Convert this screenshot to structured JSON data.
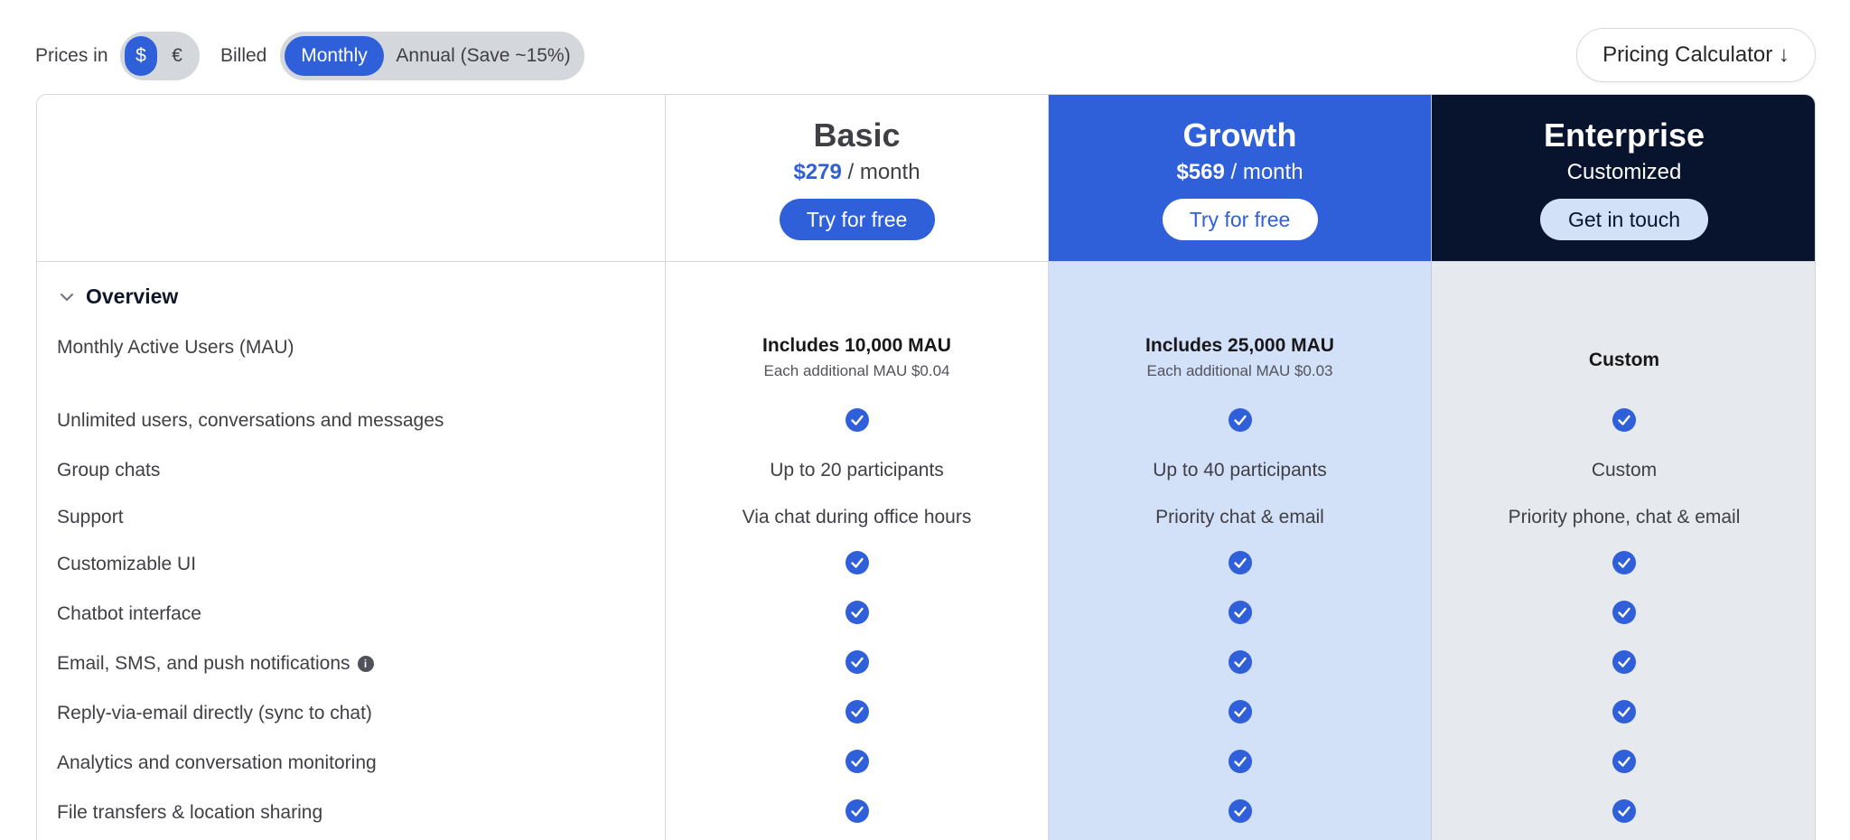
{
  "controls": {
    "prices_in_label": "Prices in",
    "currency_options": [
      "$",
      "€"
    ],
    "billed_label": "Billed",
    "billing_options": [
      "Monthly",
      "Annual (Save ~15%)"
    ],
    "selected_currency": "$",
    "selected_billing": "Monthly",
    "calculator_label": "Pricing Calculator ↓"
  },
  "plans": [
    {
      "name": "Basic",
      "price": "$279",
      "period": " / month",
      "button": "Try for free"
    },
    {
      "name": "Growth",
      "price": "$569",
      "period": " / month",
      "button": "Try for free"
    },
    {
      "name": "Enterprise",
      "price_text": "Customized",
      "button": "Get in touch"
    }
  ],
  "section": {
    "title": "Overview"
  },
  "features": {
    "mau": "Monthly Active Users (MAU)",
    "unlimited": "Unlimited users, conversations and messages",
    "group": "Group chats",
    "support": "Support",
    "custom_ui": "Customizable UI",
    "chatbot": "Chatbot interface",
    "notifications": "Email, SMS, and push notifications",
    "reply": "Reply-via-email directly (sync to chat)",
    "analytics": "Analytics and conversation monitoring",
    "files": "File transfers & location sharing"
  },
  "cells": {
    "basic": {
      "mau_main": "Includes 10,000 MAU",
      "mau_sub": "Each additional MAU $0.04",
      "group": "Up to 20 participants",
      "support": "Via chat during office hours"
    },
    "growth": {
      "mau_main": "Includes 25,000 MAU",
      "mau_sub": "Each additional MAU $0.03",
      "group": "Up to 40 participants",
      "support": "Priority chat & email"
    },
    "enterprise": {
      "mau_main": "Custom",
      "group": "Custom",
      "support": "Priority phone, chat & email"
    }
  },
  "colors": {
    "accent": "#2f5fd9",
    "growth_bg": "#d2e0f8",
    "enterprise_head": "#08142e",
    "enterprise_bg": "#e6e9ed"
  }
}
